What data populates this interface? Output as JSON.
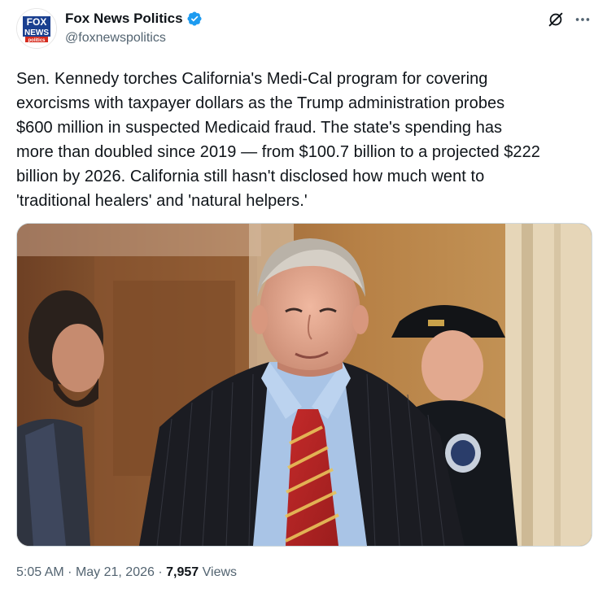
{
  "account": {
    "display_name": "Fox News Politics",
    "handle": "@foxnewspolitics",
    "verified": true,
    "avatar_logo_text": [
      "FOX",
      "NEWS",
      "politics"
    ]
  },
  "tweet": {
    "text": "Sen. Kennedy torches California's Medi-Cal program for covering\nexorcisms with taxpayer dollars as the Trump administration probes\n$600 million in suspected Medicaid fraud. The state's spending has\nmore than doubled since 2019 — from $100.7 billion to a projected $222\nbillion by 2026. California still hasn't disclosed how much went to\n'traditional healers' and 'natural helpers.'"
  },
  "meta": {
    "time": "5:05 AM",
    "separator": "·",
    "date": "May 21, 2026",
    "views_count": "7,957",
    "views_label": "Views"
  },
  "icons": {
    "verified": "verified-badge-icon",
    "grok": "grok-icon",
    "more": "more-options-icon"
  },
  "colors": {
    "verified_blue": "#1d9bf0",
    "text_primary": "#0f1419",
    "text_secondary": "#536471",
    "fox_blue": "#1a3f8f",
    "fox_red": "#d52b1e"
  }
}
